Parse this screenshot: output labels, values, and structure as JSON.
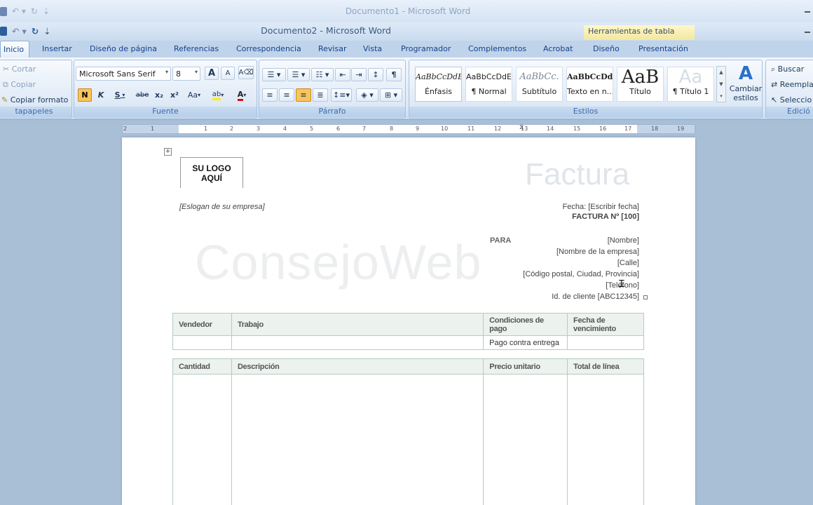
{
  "window": {
    "title_back": "Documento1 - Microsoft Word",
    "title_front": "Documento2 - Microsoft Word"
  },
  "tabs": [
    "Inicio",
    "Insertar",
    "Diseño de página",
    "Referencias",
    "Correspondencia",
    "Revisar",
    "Vista",
    "Programador",
    "Complementos",
    "Acrobat",
    "Diseño",
    "Presentación"
  ],
  "contextual_tab_group": "Herramientas de tabla",
  "clipboard": {
    "cut": "Cortar",
    "copy": "Copiar",
    "format": "Copiar formato",
    "label": "tapapeles"
  },
  "font": {
    "name": "Microsoft Sans Serif",
    "size": "8",
    "label": "Fuente",
    "bold": "N",
    "italic": "K",
    "underline": "S",
    "strike": "abe",
    "grow": "A",
    "shrink": "A",
    "case": "Aa"
  },
  "paragraph": {
    "label": "Párrafo"
  },
  "styles": {
    "label": "Estilos",
    "items": [
      {
        "preview": "AaBbCcDdE",
        "name": "Énfasis"
      },
      {
        "preview": "AaBbCcDdE",
        "name": "¶ Normal"
      },
      {
        "preview": "AaBbCc.",
        "name": "Subtítulo"
      },
      {
        "preview": "AaBbCcDdI",
        "name": "Texto en n..."
      },
      {
        "preview": "AaB",
        "name": "Título"
      },
      {
        "preview": "Aa",
        "name": "¶ Título 1"
      }
    ],
    "change": "Cambiar estilos"
  },
  "editing": {
    "find": "Buscar",
    "replace": "Reempla",
    "select": "Seleccio",
    "label": "Edició"
  },
  "ruler": {
    "numbers": [
      "2",
      "1",
      "1",
      "2",
      "3",
      "4",
      "5",
      "6",
      "7",
      "8",
      "9",
      "10",
      "11",
      "12",
      "13",
      "14",
      "15",
      "16",
      "17",
      "18",
      "19"
    ]
  },
  "doc": {
    "logo": "SU LOGO AQUÍ",
    "heading": "Factura",
    "watermark": "ConsejoWeb",
    "slogan": "[Eslogan de su empresa]",
    "date": "Fecha: [Escribir fecha]",
    "invoice_no": "FACTURA Nº [100]",
    "para": "PARA",
    "to_lines": [
      "[Nombre]",
      "[Nombre de la empresa]",
      "[Calle]",
      "[Código postal, Ciudad, Provincia]",
      "[Teléfono]",
      "Id. de cliente [ABC12345]"
    ],
    "table1": {
      "headers": [
        "Vendedor",
        "Trabajo",
        "Condiciones de pago",
        "Fecha de vencimiento"
      ],
      "row": [
        "",
        "",
        "Pago contra entrega",
        ""
      ]
    },
    "table2": {
      "headers": [
        "Cantidad",
        "Descripción",
        "Precio unitario",
        "Total de línea"
      ]
    }
  }
}
